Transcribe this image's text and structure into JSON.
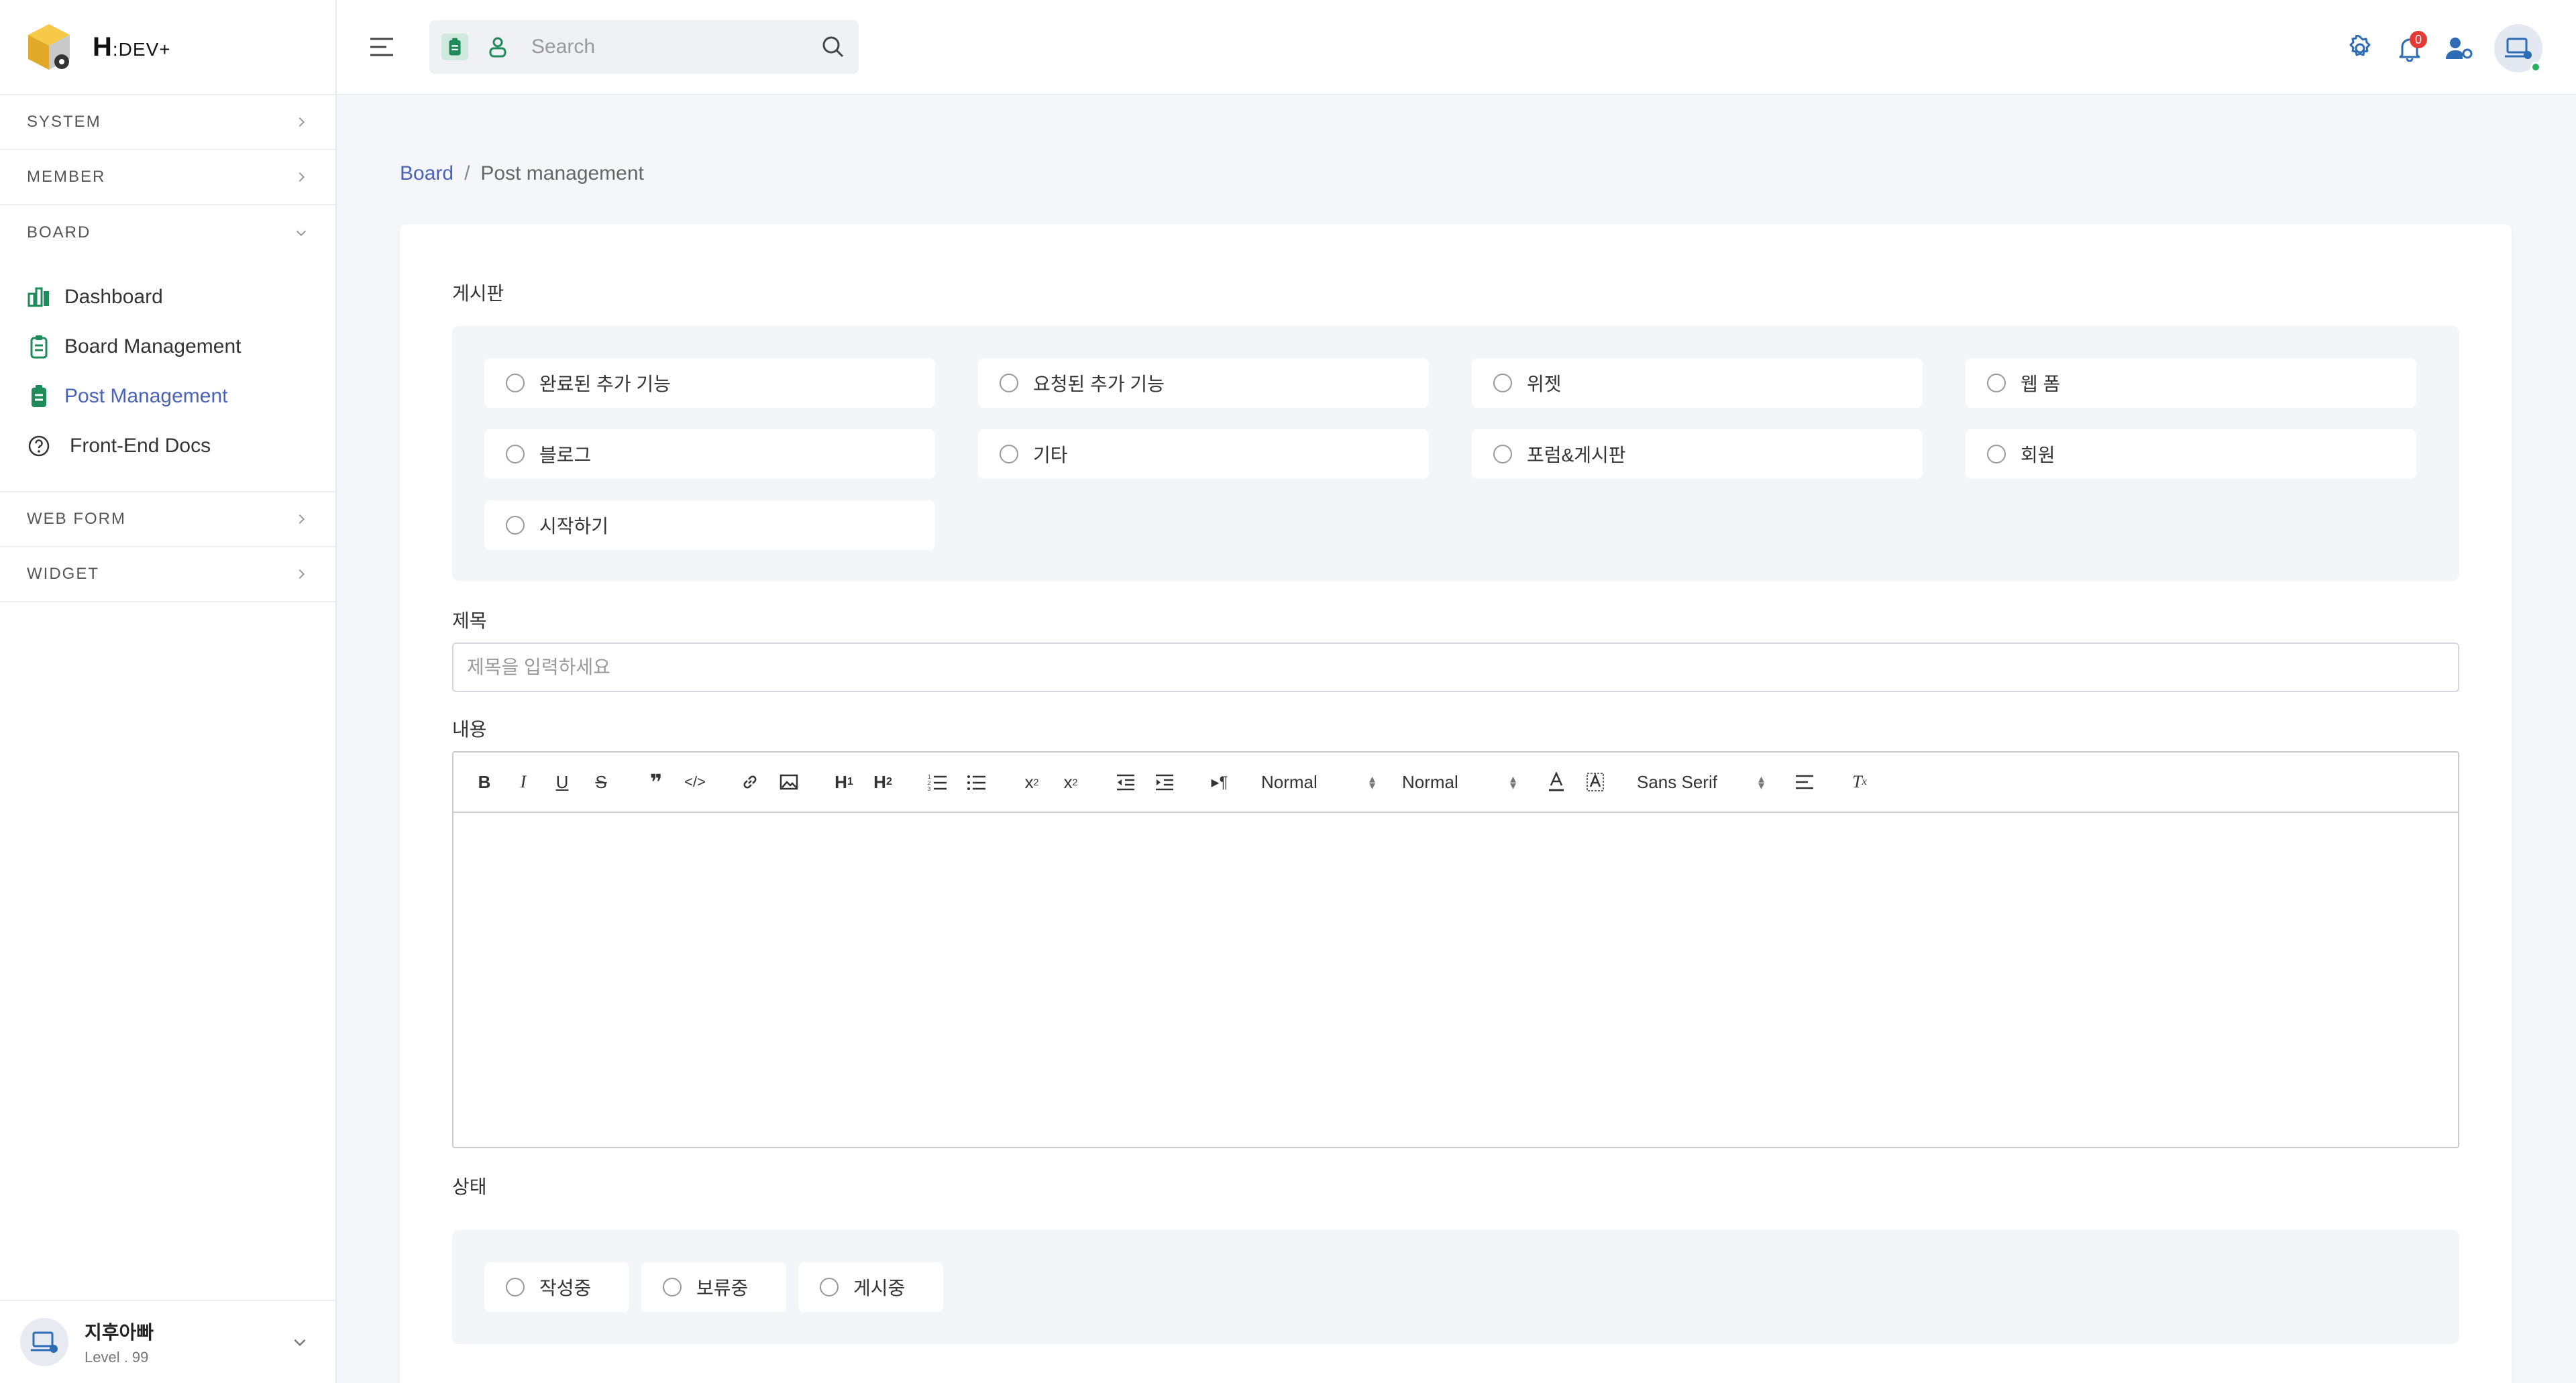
{
  "app": {
    "name": "H",
    "name_suffix": ":DEV+"
  },
  "sidebar": {
    "sections": [
      {
        "label": "SYSTEM"
      },
      {
        "label": "MEMBER"
      },
      {
        "label": "BOARD"
      },
      {
        "label": "WEB FORM"
      },
      {
        "label": "WIDGET"
      }
    ],
    "board_items": [
      {
        "label": "Dashboard",
        "icon": "bar-chart-icon"
      },
      {
        "label": "Board Management",
        "icon": "clipboard-icon"
      },
      {
        "label": "Post Management",
        "icon": "clipboard-icon",
        "active": true
      },
      {
        "label": "Front-End Docs",
        "icon": "question-circle-icon"
      }
    ],
    "user": {
      "name": "지후아빠",
      "level": "Level . 99"
    }
  },
  "header": {
    "search_placeholder": "Search",
    "notification_count": "0"
  },
  "breadcrumb": {
    "parent": "Board",
    "separator": "/",
    "current": "Post management"
  },
  "form": {
    "board_label": "게시판",
    "board_options": [
      "완료된 추가 기능",
      "요청된 추가 기능",
      "위젯",
      "웹 폼",
      "블로그",
      "기타",
      "포럼&게시판",
      "회원",
      "시작하기"
    ],
    "title_label": "제목",
    "title_placeholder": "제목을 입력하세요",
    "content_label": "내용",
    "editor": {
      "header_select": "Normal",
      "size_select": "Normal",
      "font_select": "Sans Serif"
    },
    "status_label": "상태",
    "status_options": [
      "작성중",
      "보류중",
      "게시중"
    ]
  },
  "colors": {
    "accent": "#4a62b8",
    "icon_green": "#1f8a5a",
    "badge_red": "#e53935",
    "online_green": "#27ae60"
  }
}
